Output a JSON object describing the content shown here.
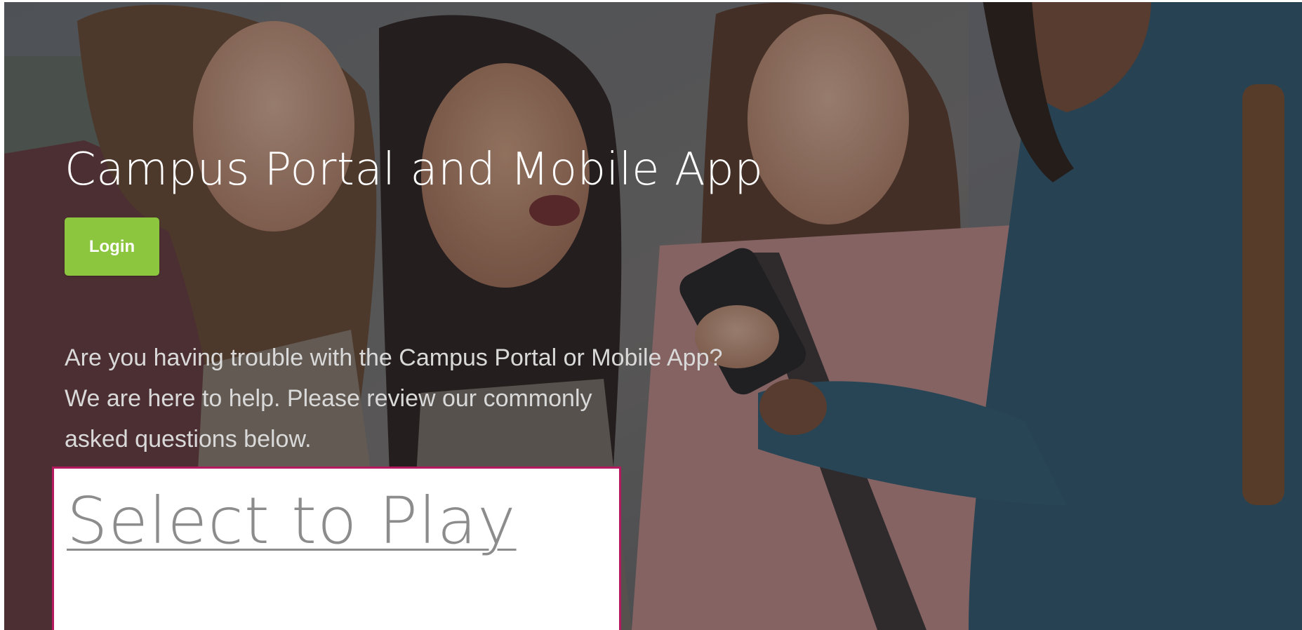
{
  "hero": {
    "title": "Campus Portal and Mobile App",
    "login_label": "Login",
    "help_lines": [
      "Are you having trouble with the Campus Portal or Mobile App?",
      "We are here to help. Please review our commonly",
      "asked questions below."
    ],
    "image_semantic": "students-looking-at-phone-photo"
  },
  "video": {
    "link_label": "Select to Play"
  },
  "colors": {
    "login_button": "#8cc63f",
    "video_border": "#b5195f",
    "link_text": "#8c8c8c",
    "help_text": "#d9d9d9",
    "title_text": "#ffffff"
  }
}
